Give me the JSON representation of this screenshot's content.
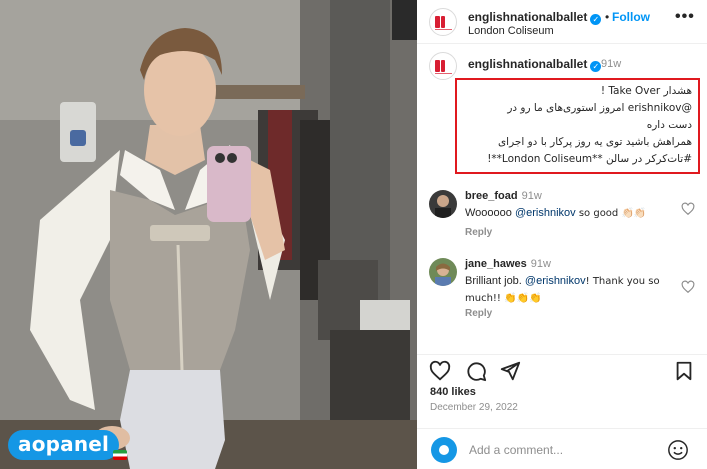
{
  "post": {
    "account": "englishnationalballet",
    "verified": true,
    "follow_label": "Follow",
    "dot": "•",
    "location": "London Coliseum",
    "more_icon": "more-horizontal-icon",
    "caption_time": "91w",
    "caption_lines": [
      "هشدار Take Over !",
      "@erishnikov امروز استوری‌های ما رو در",
      "دست داره",
      "همراهش باشید توی یه روز پرکار با دو اجرای",
      "#تات‌کرکر در سالن **London Coliseum**!"
    ]
  },
  "comments": [
    {
      "user": "bree_foad",
      "time": "91w",
      "text_prefix": "Woooooo ",
      "mention": "@erishnikov",
      "text_suffix": " so good 👏🏻👏🏻",
      "reply_label": "Reply"
    },
    {
      "user": "jane_hawes",
      "time": "91w",
      "text_prefix": "Brilliant job. ",
      "mention": "@erishnikov",
      "text_suffix": "! Thank you so much!! 👏👏👏",
      "reply_label": "Reply"
    }
  ],
  "actions": {
    "like_icon": "heart-icon",
    "comment_icon": "comment-icon",
    "share_icon": "send-icon",
    "save_icon": "bookmark-icon"
  },
  "likes": "840 likes",
  "date": "December 29, 2022",
  "add_comment": {
    "placeholder": "Add a comment...",
    "emoji_icon": "smiley-icon"
  },
  "watermark": {
    "text": "aopanel"
  },
  "colors": {
    "accent": "#0095f6",
    "highlight_box": "#e0191f",
    "brand_red": "#d81e33",
    "watermark_blue": "#1597e5",
    "muted": "#8e8e8e"
  }
}
